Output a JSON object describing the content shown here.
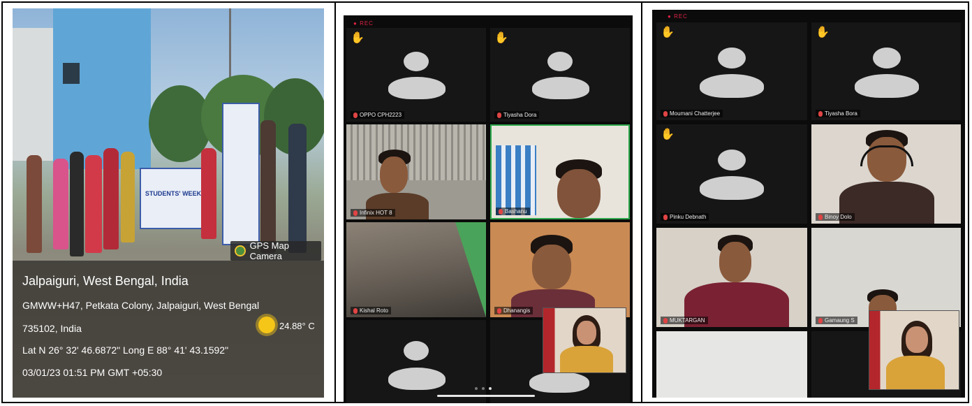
{
  "photo": {
    "gps_label": "GPS Map Camera",
    "location_title": "Jalpaiguri, West Bengal, India",
    "address_line1": "GMWW+H47, Petkata Colony, Jalpaiguri, West Bengal",
    "address_line2": "735102, India",
    "coordinates": "Lat N 26° 32' 46.6872\" Long E 88° 41' 43.1592\"",
    "datetime": "03/01/23 01:51 PM GMT +05:30",
    "temperature": "24.88° C",
    "banner_text": "STUDENTS' WEEK"
  },
  "call_middle": {
    "rec_label": "REC",
    "participants": [
      {
        "name": "OPPO CPH2223",
        "hand_raised": true
      },
      {
        "name": "Tiyasha Dora",
        "hand_raised": true
      },
      {
        "name": "Infinix HOT 8",
        "hand_raised": false
      },
      {
        "name": "Bashanu",
        "hand_raised": false
      },
      {
        "name": "Kishal Roto",
        "hand_raised": false
      },
      {
        "name": "Dhanangis",
        "hand_raised": false
      }
    ]
  },
  "call_right": {
    "rec_label": "REC",
    "participants": [
      {
        "name": "Moumani Chatterjee",
        "hand_raised": true
      },
      {
        "name": "Tiyasha Bora",
        "hand_raised": true
      },
      {
        "name": "Pinku Debnath",
        "hand_raised": true
      },
      {
        "name": "Binoy Dolo",
        "hand_raised": false
      },
      {
        "name": "MUKTARGAN",
        "hand_raised": false
      },
      {
        "name": "Gamaung S",
        "hand_raised": false
      }
    ]
  },
  "colors": {
    "mic_muted": "#e04444",
    "hand": "#f2b628",
    "active_speaker": "#2ea84d"
  }
}
